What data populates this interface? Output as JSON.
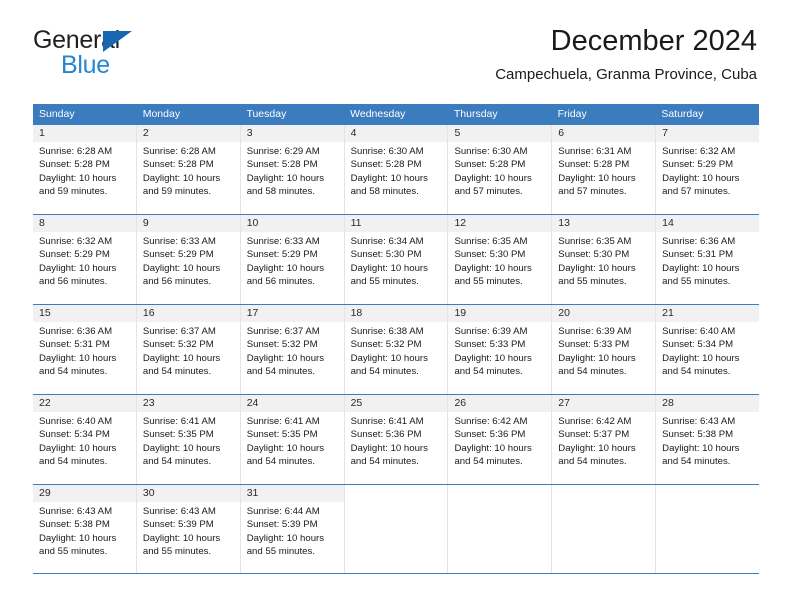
{
  "brand": {
    "name_dark": "General",
    "name_blue": "Blue",
    "accent_color": "#2487d2",
    "triangle_color": "#1666b0"
  },
  "header": {
    "title": "December 2024",
    "subtitle": "Campechuela, Granma Province, Cuba"
  },
  "calendar": {
    "header_bg": "#3a7cbe",
    "day_number_bg": "#f1f1f1",
    "weekdays": [
      "Sunday",
      "Monday",
      "Tuesday",
      "Wednesday",
      "Thursday",
      "Friday",
      "Saturday"
    ],
    "weeks": [
      [
        {
          "day": "1",
          "sunrise": "Sunrise: 6:28 AM",
          "sunset": "Sunset: 5:28 PM",
          "daylight": "Daylight: 10 hours and 59 minutes."
        },
        {
          "day": "2",
          "sunrise": "Sunrise: 6:28 AM",
          "sunset": "Sunset: 5:28 PM",
          "daylight": "Daylight: 10 hours and 59 minutes."
        },
        {
          "day": "3",
          "sunrise": "Sunrise: 6:29 AM",
          "sunset": "Sunset: 5:28 PM",
          "daylight": "Daylight: 10 hours and 58 minutes."
        },
        {
          "day": "4",
          "sunrise": "Sunrise: 6:30 AM",
          "sunset": "Sunset: 5:28 PM",
          "daylight": "Daylight: 10 hours and 58 minutes."
        },
        {
          "day": "5",
          "sunrise": "Sunrise: 6:30 AM",
          "sunset": "Sunset: 5:28 PM",
          "daylight": "Daylight: 10 hours and 57 minutes."
        },
        {
          "day": "6",
          "sunrise": "Sunrise: 6:31 AM",
          "sunset": "Sunset: 5:28 PM",
          "daylight": "Daylight: 10 hours and 57 minutes."
        },
        {
          "day": "7",
          "sunrise": "Sunrise: 6:32 AM",
          "sunset": "Sunset: 5:29 PM",
          "daylight": "Daylight: 10 hours and 57 minutes."
        }
      ],
      [
        {
          "day": "8",
          "sunrise": "Sunrise: 6:32 AM",
          "sunset": "Sunset: 5:29 PM",
          "daylight": "Daylight: 10 hours and 56 minutes."
        },
        {
          "day": "9",
          "sunrise": "Sunrise: 6:33 AM",
          "sunset": "Sunset: 5:29 PM",
          "daylight": "Daylight: 10 hours and 56 minutes."
        },
        {
          "day": "10",
          "sunrise": "Sunrise: 6:33 AM",
          "sunset": "Sunset: 5:29 PM",
          "daylight": "Daylight: 10 hours and 56 minutes."
        },
        {
          "day": "11",
          "sunrise": "Sunrise: 6:34 AM",
          "sunset": "Sunset: 5:30 PM",
          "daylight": "Daylight: 10 hours and 55 minutes."
        },
        {
          "day": "12",
          "sunrise": "Sunrise: 6:35 AM",
          "sunset": "Sunset: 5:30 PM",
          "daylight": "Daylight: 10 hours and 55 minutes."
        },
        {
          "day": "13",
          "sunrise": "Sunrise: 6:35 AM",
          "sunset": "Sunset: 5:30 PM",
          "daylight": "Daylight: 10 hours and 55 minutes."
        },
        {
          "day": "14",
          "sunrise": "Sunrise: 6:36 AM",
          "sunset": "Sunset: 5:31 PM",
          "daylight": "Daylight: 10 hours and 55 minutes."
        }
      ],
      [
        {
          "day": "15",
          "sunrise": "Sunrise: 6:36 AM",
          "sunset": "Sunset: 5:31 PM",
          "daylight": "Daylight: 10 hours and 54 minutes."
        },
        {
          "day": "16",
          "sunrise": "Sunrise: 6:37 AM",
          "sunset": "Sunset: 5:32 PM",
          "daylight": "Daylight: 10 hours and 54 minutes."
        },
        {
          "day": "17",
          "sunrise": "Sunrise: 6:37 AM",
          "sunset": "Sunset: 5:32 PM",
          "daylight": "Daylight: 10 hours and 54 minutes."
        },
        {
          "day": "18",
          "sunrise": "Sunrise: 6:38 AM",
          "sunset": "Sunset: 5:32 PM",
          "daylight": "Daylight: 10 hours and 54 minutes."
        },
        {
          "day": "19",
          "sunrise": "Sunrise: 6:39 AM",
          "sunset": "Sunset: 5:33 PM",
          "daylight": "Daylight: 10 hours and 54 minutes."
        },
        {
          "day": "20",
          "sunrise": "Sunrise: 6:39 AM",
          "sunset": "Sunset: 5:33 PM",
          "daylight": "Daylight: 10 hours and 54 minutes."
        },
        {
          "day": "21",
          "sunrise": "Sunrise: 6:40 AM",
          "sunset": "Sunset: 5:34 PM",
          "daylight": "Daylight: 10 hours and 54 minutes."
        }
      ],
      [
        {
          "day": "22",
          "sunrise": "Sunrise: 6:40 AM",
          "sunset": "Sunset: 5:34 PM",
          "daylight": "Daylight: 10 hours and 54 minutes."
        },
        {
          "day": "23",
          "sunrise": "Sunrise: 6:41 AM",
          "sunset": "Sunset: 5:35 PM",
          "daylight": "Daylight: 10 hours and 54 minutes."
        },
        {
          "day": "24",
          "sunrise": "Sunrise: 6:41 AM",
          "sunset": "Sunset: 5:35 PM",
          "daylight": "Daylight: 10 hours and 54 minutes."
        },
        {
          "day": "25",
          "sunrise": "Sunrise: 6:41 AM",
          "sunset": "Sunset: 5:36 PM",
          "daylight": "Daylight: 10 hours and 54 minutes."
        },
        {
          "day": "26",
          "sunrise": "Sunrise: 6:42 AM",
          "sunset": "Sunset: 5:36 PM",
          "daylight": "Daylight: 10 hours and 54 minutes."
        },
        {
          "day": "27",
          "sunrise": "Sunrise: 6:42 AM",
          "sunset": "Sunset: 5:37 PM",
          "daylight": "Daylight: 10 hours and 54 minutes."
        },
        {
          "day": "28",
          "sunrise": "Sunrise: 6:43 AM",
          "sunset": "Sunset: 5:38 PM",
          "daylight": "Daylight: 10 hours and 54 minutes."
        }
      ],
      [
        {
          "day": "29",
          "sunrise": "Sunrise: 6:43 AM",
          "sunset": "Sunset: 5:38 PM",
          "daylight": "Daylight: 10 hours and 55 minutes."
        },
        {
          "day": "30",
          "sunrise": "Sunrise: 6:43 AM",
          "sunset": "Sunset: 5:39 PM",
          "daylight": "Daylight: 10 hours and 55 minutes."
        },
        {
          "day": "31",
          "sunrise": "Sunrise: 6:44 AM",
          "sunset": "Sunset: 5:39 PM",
          "daylight": "Daylight: 10 hours and 55 minutes."
        },
        {
          "day": "",
          "sunrise": "",
          "sunset": "",
          "daylight": ""
        },
        {
          "day": "",
          "sunrise": "",
          "sunset": "",
          "daylight": ""
        },
        {
          "day": "",
          "sunrise": "",
          "sunset": "",
          "daylight": ""
        },
        {
          "day": "",
          "sunrise": "",
          "sunset": "",
          "daylight": ""
        }
      ]
    ]
  }
}
